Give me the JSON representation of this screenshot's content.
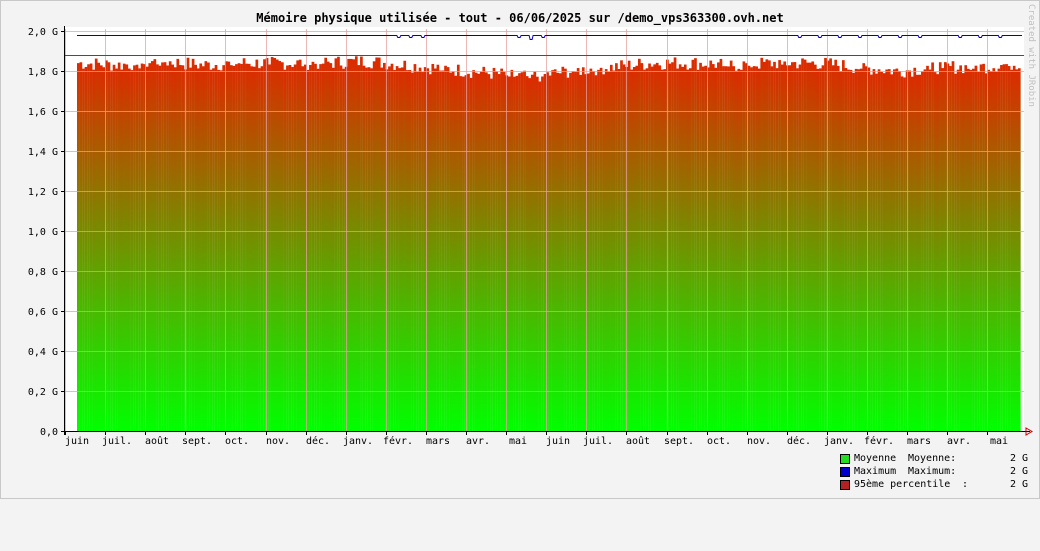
{
  "chart_data": {
    "type": "bar",
    "title": "Mémoire physique utilisée - tout - 06/06/2025 sur /demo_vps363300.ovh.net",
    "watermark": "Created with JRobin",
    "ylim": [
      0,
      2.0
    ],
    "y_ticks": [
      {
        "value": 0.0,
        "label": "0,0"
      },
      {
        "value": 0.2,
        "label": "0,2 G"
      },
      {
        "value": 0.4,
        "label": "0,4 G"
      },
      {
        "value": 0.6,
        "label": "0,6 G"
      },
      {
        "value": 0.8,
        "label": "0,8 G"
      },
      {
        "value": 1.0,
        "label": "1,0 G"
      },
      {
        "value": 1.2,
        "label": "1,2 G"
      },
      {
        "value": 1.4,
        "label": "1,4 G"
      },
      {
        "value": 1.6,
        "label": "1,6 G"
      },
      {
        "value": 1.8,
        "label": "1,8 G"
      },
      {
        "value": 2.0,
        "label": "2,0 G"
      }
    ],
    "x_ticks": [
      "juin",
      "juil.",
      "août",
      "sept.",
      "oct.",
      "nov.",
      "déc.",
      "janv.",
      "févr.",
      "mars",
      "avr.",
      "mai",
      "juin",
      "juil.",
      "août",
      "sept.",
      "oct.",
      "nov.",
      "déc.",
      "janv.",
      "févr.",
      "mars",
      "avr.",
      "mai"
    ],
    "grid": true,
    "colors": {
      "bottom": "#00ff00",
      "top": "#dd2a00",
      "max": "#0000cc",
      "percentile": "#b22222",
      "grid": "#e6a0a0",
      "plot_bg": "#ffffff"
    },
    "percentile_95": 1.88,
    "max_baseline": 1.98,
    "max_dips": [
      {
        "month": 8.0,
        "value": 1.97
      },
      {
        "month": 8.3,
        "value": 1.97
      },
      {
        "month": 8.6,
        "value": 1.97
      },
      {
        "month": 11.0,
        "value": 1.97
      },
      {
        "month": 11.3,
        "value": 1.96
      },
      {
        "month": 11.6,
        "value": 1.97
      },
      {
        "month": 18.0,
        "value": 1.97
      },
      {
        "month": 18.5,
        "value": 1.97
      },
      {
        "month": 19.0,
        "value": 1.97
      },
      {
        "month": 19.5,
        "value": 1.97
      },
      {
        "month": 20.0,
        "value": 1.97
      },
      {
        "month": 20.5,
        "value": 1.97
      },
      {
        "month": 21.0,
        "value": 1.97
      },
      {
        "month": 22.0,
        "value": 1.97
      },
      {
        "month": 22.5,
        "value": 1.97
      },
      {
        "month": 23.0,
        "value": 1.97
      }
    ],
    "series": [
      {
        "name": "Moyenne",
        "values_by_month": [
          1.84,
          1.83,
          1.85,
          1.83,
          1.84,
          1.84,
          1.84,
          1.85,
          1.83,
          1.81,
          1.79,
          1.77,
          1.8,
          1.82,
          1.84,
          1.84,
          1.83,
          1.84,
          1.84,
          1.82,
          1.8,
          1.82,
          1.82,
          1.84
        ]
      }
    ]
  },
  "legend": [
    {
      "color": "#22dd22",
      "name": "Moyenne",
      "label": "Moyenne:",
      "value": "2 G"
    },
    {
      "color": "#0000cc",
      "name": "Maximum",
      "label": "Maximum:",
      "value": "2 G"
    },
    {
      "color": "#b22222",
      "name": "95ème percentile",
      "label": ":",
      "value": "2 G"
    }
  ]
}
